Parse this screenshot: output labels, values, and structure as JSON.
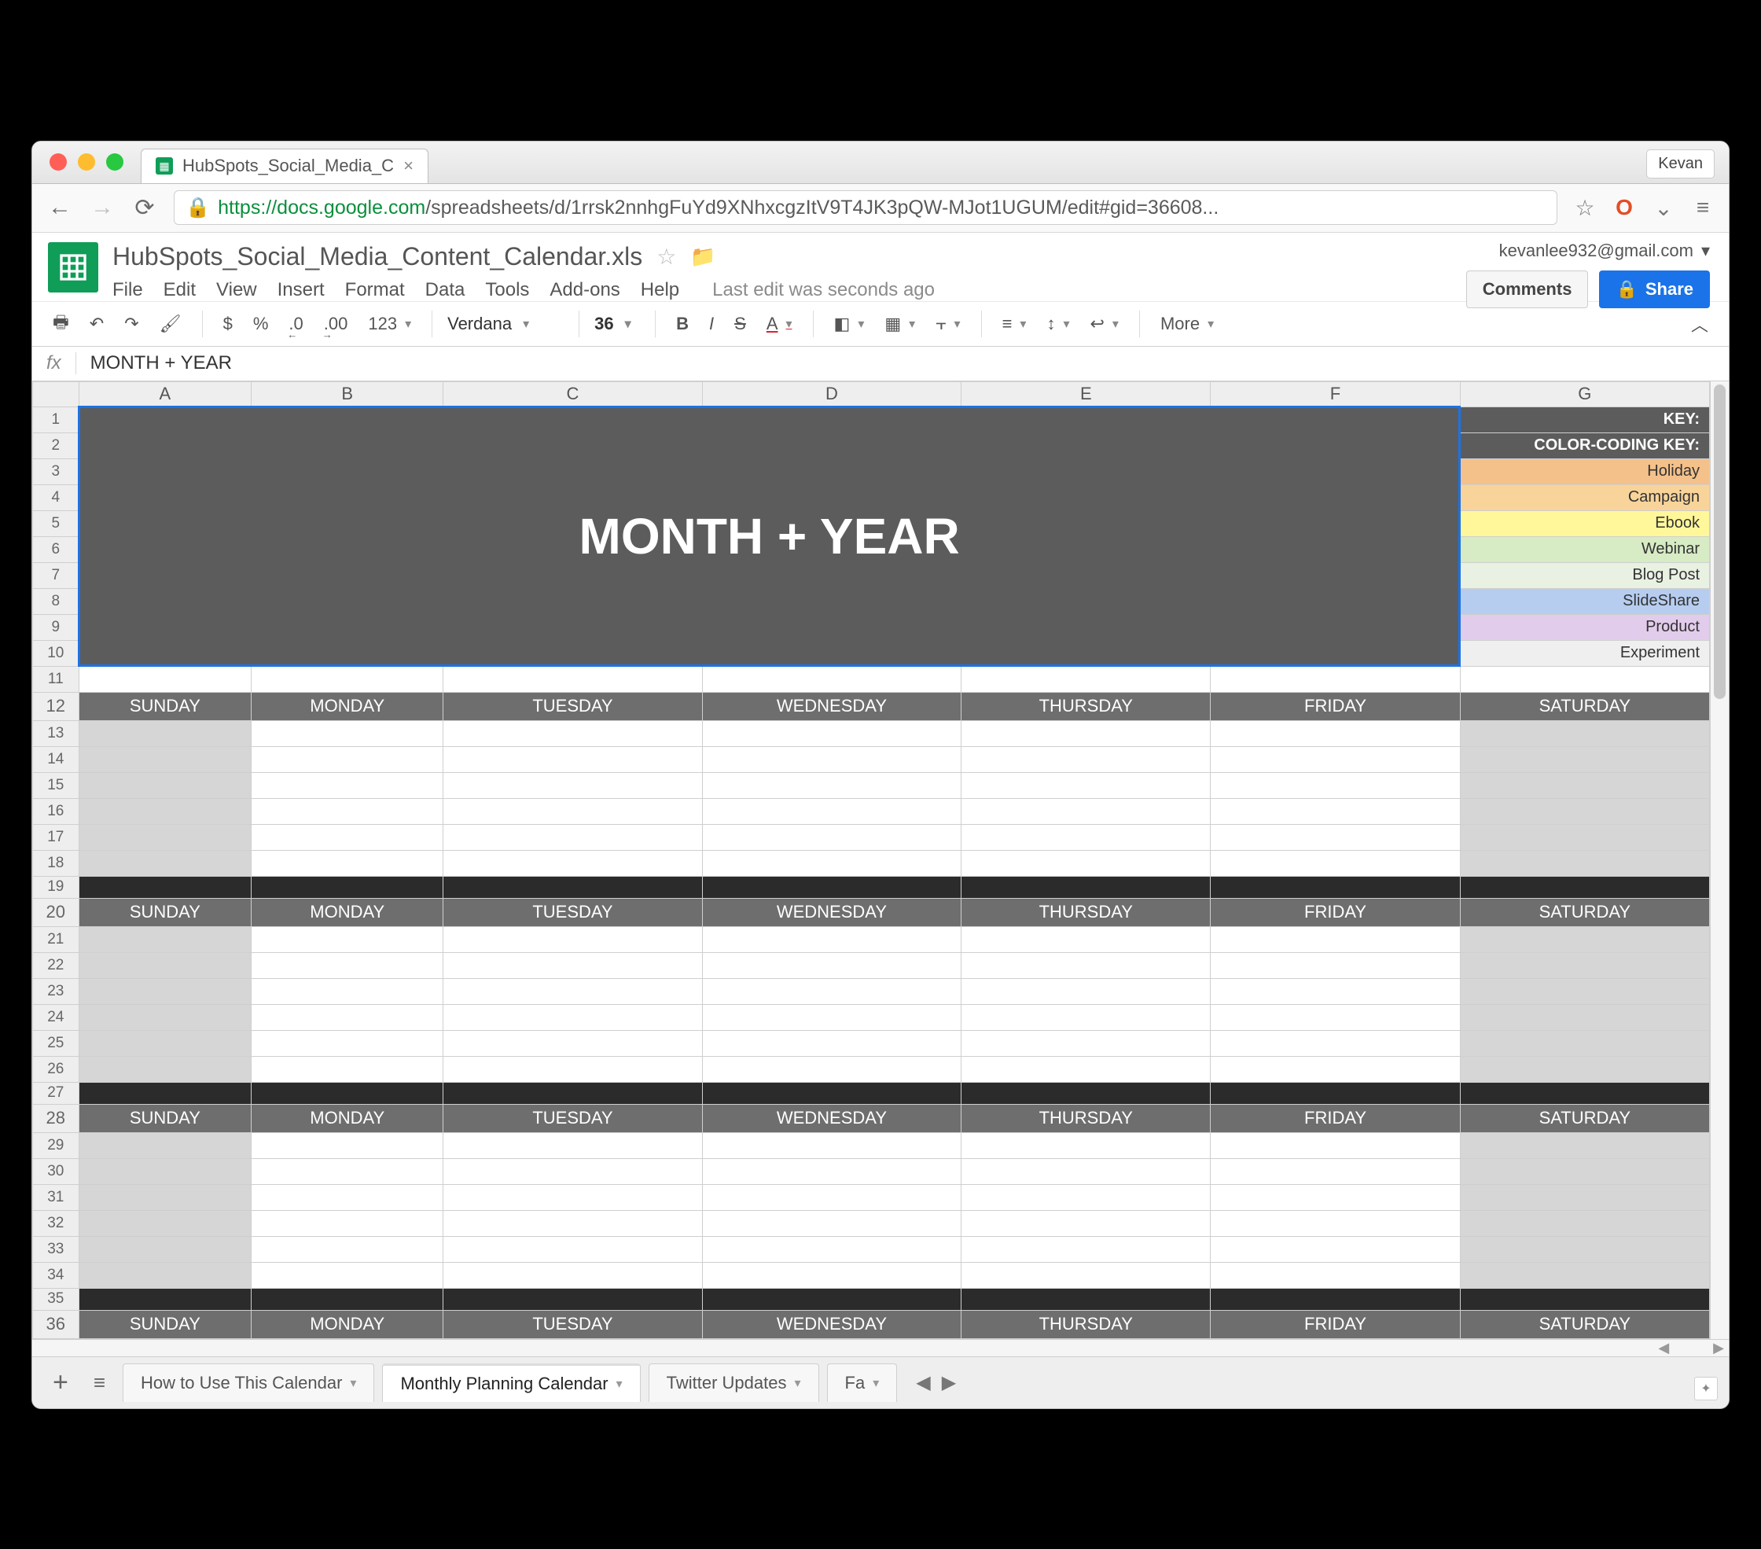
{
  "window": {
    "user_button": "Kevan"
  },
  "browser_tab": {
    "title": "HubSpots_Social_Media_C"
  },
  "url": {
    "scheme": "https",
    "host": "://docs.google.com",
    "path": "/spreadsheets/d/1rrsk2nnhgFuYd9XNhxcgzItV9T4JK3pQW-MJot1UGUM/edit#gid=36608..."
  },
  "doc": {
    "title": "HubSpots_Social_Media_Content_Calendar.xls",
    "email": "kevanlee932@gmail.com",
    "comments_btn": "Comments",
    "share_btn": "Share",
    "edit_status": "Last edit was seconds ago",
    "menus": [
      "File",
      "Edit",
      "View",
      "Insert",
      "Format",
      "Data",
      "Tools",
      "Add-ons",
      "Help"
    ]
  },
  "toolbar": {
    "currency": "$",
    "percent": "%",
    "dec_less": ".0",
    "dec_more": ".00",
    "numfmt": "123",
    "font": "Verdana",
    "size": "36",
    "more": "More"
  },
  "fx": {
    "value": "MONTH + YEAR"
  },
  "columns": [
    "A",
    "B",
    "C",
    "D",
    "E",
    "F",
    "G"
  ],
  "title_cell": "MONTH + YEAR",
  "key": {
    "title": "KEY:",
    "subtitle": "COLOR-CODING KEY:",
    "items": [
      {
        "label": "Holiday",
        "color": "#f4c18a"
      },
      {
        "label": "Campaign",
        "color": "#f8d49a"
      },
      {
        "label": "Ebook",
        "color": "#fff79a"
      },
      {
        "label": "Webinar",
        "color": "#d7ebc5"
      },
      {
        "label": "Blog Post",
        "color": "#e8f1e2"
      },
      {
        "label": "SlideShare",
        "color": "#b6cdf0"
      },
      {
        "label": "Product",
        "color": "#e2cceb"
      },
      {
        "label": "Experiment",
        "color": "#efefef"
      }
    ]
  },
  "days": [
    "SUNDAY",
    "MONDAY",
    "TUESDAY",
    "WEDNESDAY",
    "THURSDAY",
    "FRIDAY",
    "SATURDAY"
  ],
  "row_numbers": [
    1,
    2,
    3,
    4,
    5,
    6,
    7,
    8,
    9,
    10,
    11,
    12,
    13,
    14,
    15,
    16,
    17,
    18,
    19,
    20,
    21,
    22,
    23,
    24,
    25,
    26,
    27,
    28,
    29,
    30,
    31,
    32,
    33,
    34,
    35,
    36
  ],
  "sheet_tabs": [
    {
      "label": "How to Use This Calendar",
      "active": false
    },
    {
      "label": "Monthly Planning Calendar",
      "active": true
    },
    {
      "label": "Twitter Updates",
      "active": false
    },
    {
      "label": "Fa",
      "active": false
    }
  ]
}
